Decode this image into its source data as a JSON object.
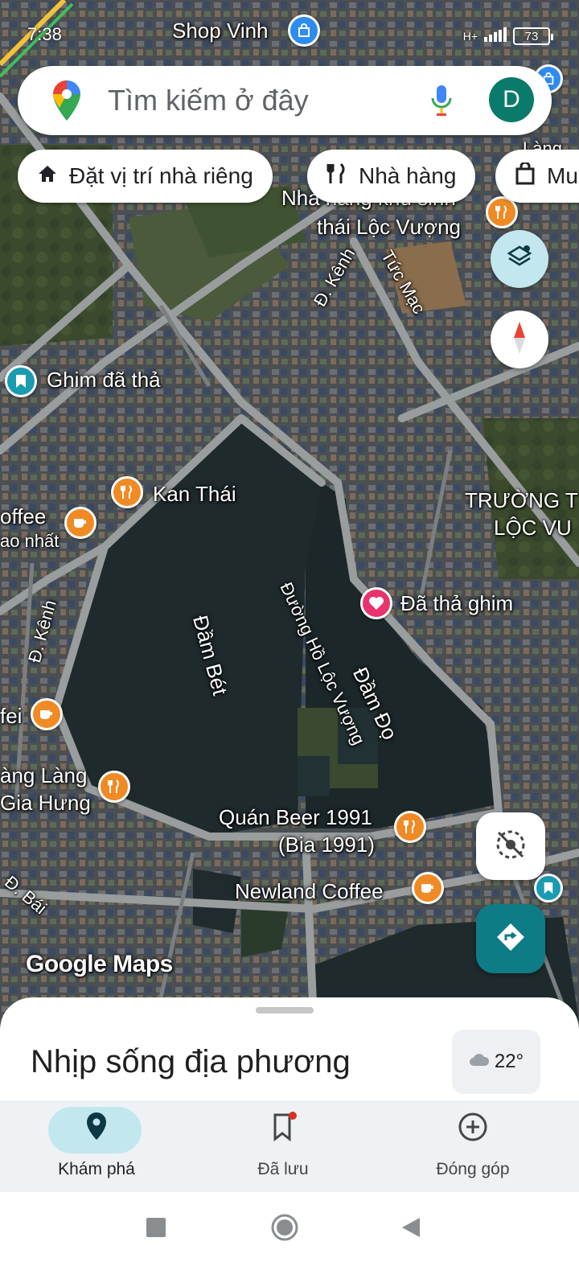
{
  "status_bar": {
    "time": "7:38",
    "network": "H+",
    "battery": "73"
  },
  "search": {
    "placeholder": "Tìm kiếm ở đây",
    "avatar_letter": "D"
  },
  "chips": [
    {
      "label": "Đặt vị trí nhà riêng",
      "icon": "home-icon"
    },
    {
      "label": "Nhà hàng",
      "icon": "restaurant-icon"
    },
    {
      "label": "Mu",
      "icon": "shopping-bag-icon"
    }
  ],
  "map_labels": {
    "shop_vinh": "Shop Vinh",
    "nha_hang_khu_sinh_thai": "Nhà hàng khu sinh",
    "thai_loc_vuong": "thái Lộc Vượng",
    "d_kenh_top": "Đ. Kênh",
    "tuc_mac": "Tức Mạc",
    "ghim_da_tha": "Ghim đã thả",
    "kan_thai": "Kan Thái",
    "coffee_left": "offee",
    "coffee_left_sub": "ao nhất",
    "truong_line1": "TRƯỜNG T",
    "truong_line2": "LỘC VU",
    "duong_ho_loc_vuong": "Đường Hồ Lộc Vượng",
    "da_tha_ghim": "Đã thả ghim",
    "d_kenh_left": "Đ. Kênh",
    "dam_bet": "Đầm Bét",
    "dam_do": "Đầm Đọ",
    "cafe_left": "fei",
    "lang_lang": "àng Làng",
    "gia_hung": "Gia Hưng",
    "quan_beer": "Quán Beer 1991",
    "bia_1991": "(Bia 1991)",
    "newland": "Newland Coffee",
    "d_bai": "Đ. Bái",
    "google_maps": "Google Maps",
    "lang_top_right": "Làng"
  },
  "sheet": {
    "title": "Nhịp sống địa phương",
    "temperature": "22°",
    "weather_icon": "cloud-icon"
  },
  "nav": [
    {
      "label": "Khám phá",
      "icon": "location-pin-icon",
      "active": true
    },
    {
      "label": "Đã lưu",
      "icon": "bookmark-icon",
      "badge": true
    },
    {
      "label": "Đóng góp",
      "icon": "add-circle-icon"
    }
  ],
  "colors": {
    "accent_teal": "#0a7a6a",
    "pin_orange": "#f08a24",
    "pin_pink": "#e8336d",
    "nav_active_pill": "#c2e7ef"
  }
}
